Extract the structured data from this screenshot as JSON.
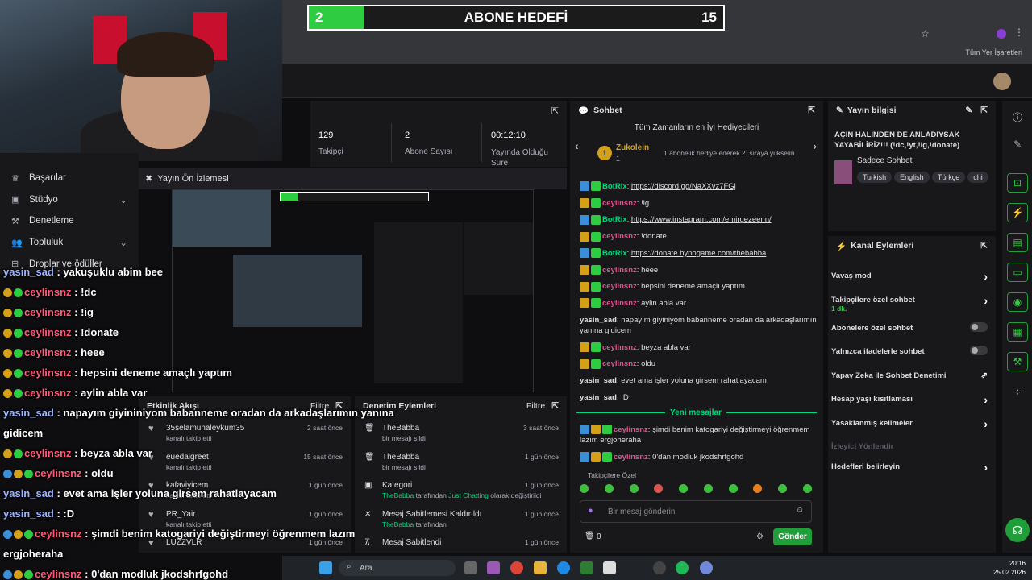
{
  "goal": {
    "current": "2",
    "title": "ABONE HEDEFİ",
    "target": "15",
    "fill": 0.133
  },
  "browser": {
    "bookmarks_label": "Tüm Yer İşaretleri"
  },
  "sidenav": {
    "items": [
      "Başarılar",
      "Stüdyo",
      "Denetleme",
      "Topluluk",
      "Droplar ve ödüller"
    ]
  },
  "stats": [
    {
      "value": "129",
      "label": "Takipçi"
    },
    {
      "value": "2",
      "label": "Abone Sayısı"
    },
    {
      "value": "00:12:10",
      "label": "Yayında Olduğu Süre"
    }
  ],
  "preview": {
    "title": "Yayın Ön İzlemesi"
  },
  "overlay_chat": [
    {
      "user": "yasin_sad",
      "text": " : yakuşuklu abim bee",
      "style": "u1",
      "badges": 0
    },
    {
      "user": "ceylinsnz",
      "text": " : !dc",
      "style": "u2",
      "badges": 2
    },
    {
      "user": "ceylinsnz",
      "text": " : !ig",
      "style": "u2",
      "badges": 2
    },
    {
      "user": "ceylinsnz",
      "text": " : !donate",
      "style": "u2",
      "badges": 2
    },
    {
      "user": "ceylinsnz",
      "text": " : heee",
      "style": "u2",
      "badges": 2
    },
    {
      "user": "ceylinsnz",
      "text": " : hepsini deneme amaçlı yaptım",
      "style": "u2",
      "badges": 2
    },
    {
      "user": "ceylinsnz",
      "text": " : aylin abla var",
      "style": "u2",
      "badges": 2
    },
    {
      "user": "yasin_sad",
      "text": " : napayım giyininiyom babanneme oradan da arkadaşlarımın yanına",
      "style": "u1",
      "badges": 0
    },
    {
      "user": "",
      "text": "gidicem",
      "style": "u1",
      "badges": 0
    },
    {
      "user": "ceylinsnz",
      "text": " : beyza abla var",
      "style": "u2",
      "badges": 2
    },
    {
      "user": "ceylinsnz",
      "text": " : oldu",
      "style": "u2",
      "badges": 3
    },
    {
      "user": "yasin_sad",
      "text": " : evet ama işler yoluna girsem rahatlayacam",
      "style": "u1",
      "badges": 0
    },
    {
      "user": "yasin_sad",
      "text": " : :D",
      "style": "u1",
      "badges": 0
    },
    {
      "user": "ceylinsnz",
      "text": " : şimdi benim katogariyi değiştirmeyi öğrenmem lazım",
      "style": "u2",
      "badges": 3
    },
    {
      "user": "",
      "text": "ergjoheraha",
      "style": "u1",
      "badges": 0
    },
    {
      "user": "ceylinsnz",
      "text": " : 0'dan modluk jkodshrfgohd",
      "style": "u2",
      "badges": 3
    }
  ],
  "activity": {
    "title": "Etkinlik Akışı",
    "filter": "Filtre",
    "rows": [
      {
        "name": "35selamunaleykum35",
        "sub": "kanalı takip etti",
        "time": "2 saat önce"
      },
      {
        "name": "euedaigreet",
        "sub": "kanalı takip etti",
        "time": "15 saat önce"
      },
      {
        "name": "kafaviyicem",
        "sub": "kanalı takip etti",
        "time": "1 gün önce"
      },
      {
        "name": "PR_Yair",
        "sub": "kanalı takip etti",
        "time": "1 gün önce"
      },
      {
        "name": "LUZZVLR",
        "sub": "",
        "time": "1 gün önce"
      }
    ]
  },
  "modactions": {
    "title": "Denetim Eylemleri",
    "filter": "Filtre",
    "rows": [
      {
        "name": "TheBabba",
        "sub": "bir mesajı sildi",
        "time": "3 saat önce"
      },
      {
        "name": "TheBabba",
        "sub": "bir mesajı sildi",
        "time": "1 gün önce"
      },
      {
        "name": "Kategori",
        "sub1": "TheBabba",
        "sub2": " tarafından ",
        "sub3": "Just Chatting",
        "sub4": " olarak değiştirildi",
        "time": "1 gün önce"
      },
      {
        "name": "Mesaj Sabitlemesi Kaldırıldı",
        "sub1": "TheBabba",
        "sub2": " tarafından",
        "time": "1 gün önce"
      },
      {
        "name": "Mesaj Sabitlendi",
        "sub": "",
        "time": "1 gün önce"
      }
    ]
  },
  "chat": {
    "title": "Sohbet",
    "gifters_title": "Tüm Zamanların en İyi Hediyecileri",
    "gifter": "Zukolein",
    "gifter_count": "1",
    "gifter_hint": "1 abonelik hediye ederek 2. sıraya yükselin",
    "messages": [
      {
        "user": "BotRix",
        "kind": "bot",
        "text": "https://discord.gg/NaXXvz7FGj",
        "link": true
      },
      {
        "user": "ceylinsnz",
        "kind": "n1",
        "text": "!ig"
      },
      {
        "user": "BotRix",
        "kind": "bot",
        "text": "https://www.instagram.com/emirgezeenn/",
        "link": true
      },
      {
        "user": "ceylinsnz",
        "kind": "n1",
        "text": "!donate"
      },
      {
        "user": "BotRix",
        "kind": "bot",
        "text": "https://donate.bynogame.com/thebabba",
        "link": true
      },
      {
        "user": "ceylinsnz",
        "kind": "n1",
        "text": "heee"
      },
      {
        "user": "ceylinsnz",
        "kind": "n1",
        "text": "hepsini deneme amaçlı yaptım"
      },
      {
        "user": "ceylinsnz",
        "kind": "n1",
        "text": "aylin abla var"
      },
      {
        "user": "yasin_sad",
        "kind": "n2",
        "text": "napayım giyiniyom babanneme oradan da arkadaşlarımın yanına gidicem"
      },
      {
        "user": "ceylinsnz",
        "kind": "n1",
        "text": "beyza abla var"
      },
      {
        "user": "ceylinsnz",
        "kind": "n1",
        "text": "oldu"
      },
      {
        "user": "yasin_sad",
        "kind": "n2",
        "text": "evet ama işler yoluna girsem rahatlayacam"
      },
      {
        "user": "yasin_sad",
        "kind": "n2",
        "text": ":D"
      }
    ],
    "new_messages": "Yeni mesajlar",
    "new": [
      {
        "user": "ceylinsnz",
        "text": "şimdi benim katogariyi değiştirmeyi öğrenmem lazım ergjoheraha"
      },
      {
        "user": "ceylinsnz",
        "text": "0'dan modluk jkodshrfgohd"
      }
    ],
    "mode": "Takipçilere Özel",
    "placeholder": "Bir mesaj gönderin",
    "points": "0",
    "send": "Gönder"
  },
  "info": {
    "title": "Yayın bilgisi",
    "stream_title": "AÇIN HALİNDEN DE ANLADIYSAK YAYABİLİRİZ!!! (!dc,!yt,!ig,!donate)",
    "category": "Sadece Sohbet",
    "tags": [
      "Turkish",
      "English",
      "Türkçe",
      "chi"
    ]
  },
  "actions": {
    "title": "Kanal Eylemleri",
    "items": [
      {
        "label": "Vavaş mod",
        "ctrl": "chev"
      },
      {
        "label": "Takipçilere özel sohbet",
        "sub": "1 dk.",
        "ctrl": "chev"
      },
      {
        "label": "Abonelere özel sohbet",
        "ctrl": "toggle"
      },
      {
        "label": "Yalnızca ifadelerle sohbet",
        "ctrl": "toggle"
      },
      {
        "label": "Yapay Zeka ile Sohbet Denetimi",
        "ctrl": "ext"
      },
      {
        "label": "Hesap yaşı kısıtlaması",
        "ctrl": "chev"
      },
      {
        "label": "Yasaklanmış kelimeler",
        "ctrl": "chev"
      },
      {
        "label": "İzleyici Yönlendir",
        "ctrl": "none",
        "dim": true
      },
      {
        "label": "Hedefleri belirleyin",
        "ctrl": "chev"
      }
    ]
  },
  "taskbar": {
    "search": "Ara",
    "time": "20:16",
    "date": "25.02.2026"
  },
  "colors": {
    "accent": "#2ecc40",
    "bg": "#0e0e10",
    "panel": "#18181b",
    "mod": "#00d982"
  }
}
